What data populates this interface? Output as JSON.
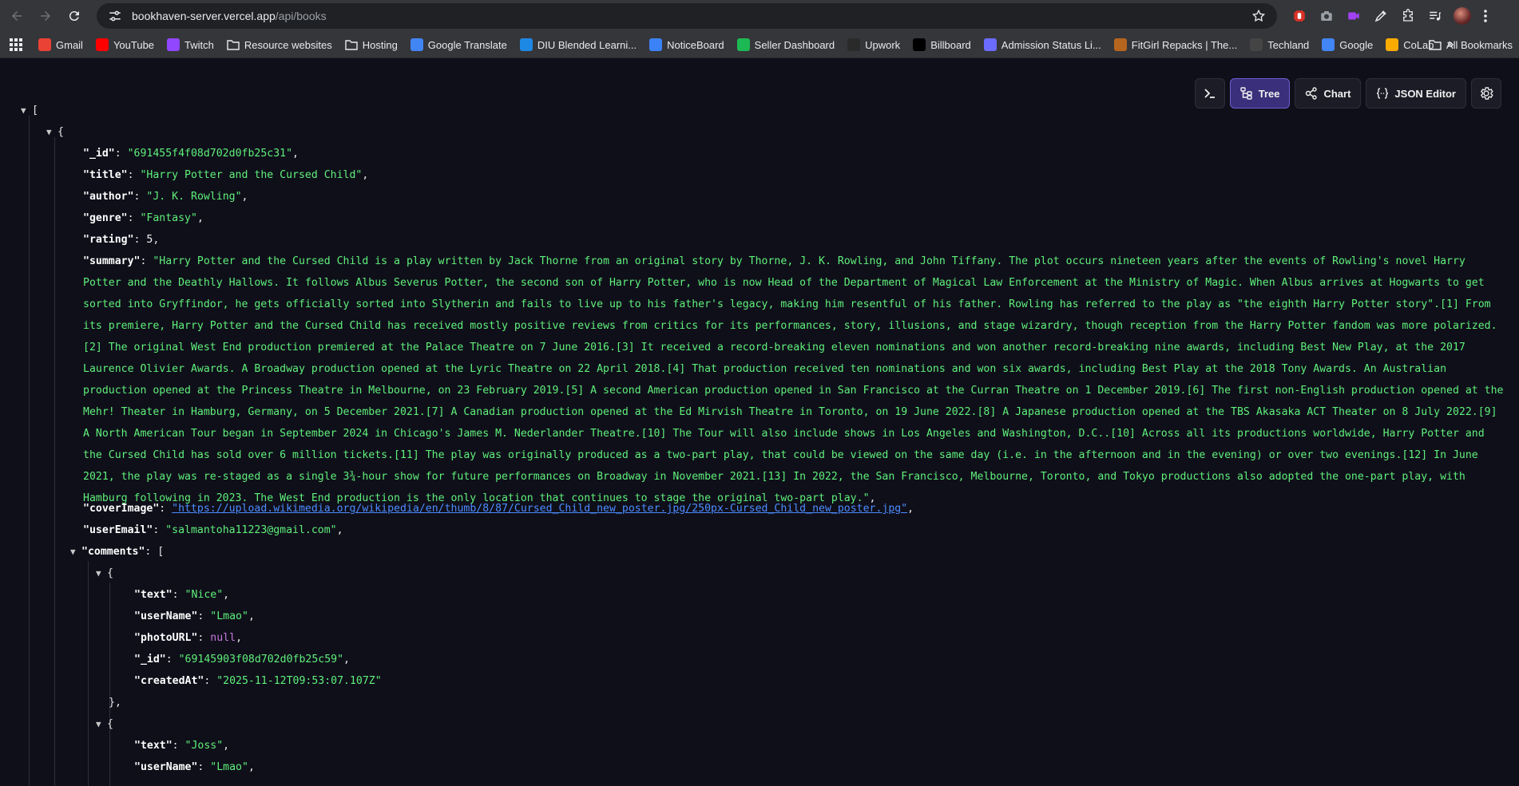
{
  "browser": {
    "url_host": "bookhaven-server.vercel.app",
    "url_path": "/api/books",
    "bookmarks": [
      {
        "label": "Gmail",
        "icon": "gmail-icon",
        "color": "#ea4335"
      },
      {
        "label": "YouTube",
        "icon": "youtube-icon",
        "color": "#ff0000"
      },
      {
        "label": "Twitch",
        "icon": "twitch-icon",
        "color": "#9146ff"
      },
      {
        "label": "Resource websites",
        "icon": "folder-icon",
        "color": ""
      },
      {
        "label": "Hosting",
        "icon": "folder-icon",
        "color": ""
      },
      {
        "label": "Google Translate",
        "icon": "translate-icon",
        "color": "#4285f4"
      },
      {
        "label": "DIU Blended Learni...",
        "icon": "diu-icon",
        "color": "#1e88e5"
      },
      {
        "label": "NoticeBoard",
        "icon": "noticeboard-icon",
        "color": "#3b82f6"
      },
      {
        "label": "Seller Dashboard",
        "icon": "seller-icon",
        "color": "#1db954"
      },
      {
        "label": "Upwork",
        "icon": "upwork-icon",
        "color": "#2a2a2a"
      },
      {
        "label": "Billboard",
        "icon": "billboard-icon",
        "color": "#000000"
      },
      {
        "label": "Admission Status Li...",
        "icon": "admission-icon",
        "color": "#6b6bff"
      },
      {
        "label": "FitGirl Repacks | The...",
        "icon": "fitgirl-icon",
        "color": "#b5651d"
      },
      {
        "label": "Techland",
        "icon": "techland-icon",
        "color": "#444444"
      },
      {
        "label": "Google",
        "icon": "google-icon",
        "color": "#4285f4"
      },
      {
        "label": "CoLab",
        "icon": "colab-icon",
        "color": "#f9ab00"
      }
    ],
    "all_bookmarks_label": "All Bookmarks"
  },
  "viewer": {
    "tree_label": "Tree",
    "chart_label": "Chart",
    "json_editor_label": "JSON Editor"
  },
  "json": {
    "open_bracket": "[",
    "open_brace": "{",
    "id_key": "\"_id\"",
    "id_val": "\"691455f4f08d702d0fb25c31\"",
    "title_key": "\"title\"",
    "title_val": "\"Harry Potter and the Cursed Child\"",
    "author_key": "\"author\"",
    "author_val": "\"J. K. Rowling\"",
    "genre_key": "\"genre\"",
    "genre_val": "\"Fantasy\"",
    "rating_key": "\"rating\"",
    "rating_val": "5",
    "summary_key": "\"summary\"",
    "summary_val": "\"Harry Potter and the Cursed Child is a play written by Jack Thorne from an original story by Thorne, J. K. Rowling, and John Tiffany. The plot occurs nineteen years after the events of Rowling's novel Harry Potter and the Deathly Hallows. It follows Albus Severus Potter, the second son of Harry Potter, who is now Head of the Department of Magical Law Enforcement at the Ministry of Magic. When Albus arrives at Hogwarts to get sorted into Gryffindor, he gets officially sorted into Slytherin and fails to live up to his father's legacy, making him resentful of his father. Rowling has referred to the play as \"the eighth Harry Potter story\".[1] From its premiere, Harry Potter and the Cursed Child has received mostly positive reviews from critics for its performances, story, illusions, and stage wizardry, though reception from the Harry Potter fandom was more polarized.[2] The original West End production premiered at the Palace Theatre on 7 June 2016.[3] It received a record-breaking eleven nominations and won another record-breaking nine awards, including Best New Play, at the 2017 Laurence Olivier Awards. A Broadway production opened at the Lyric Theatre on 22 April 2018.[4] That production received ten nominations and won six awards, including Best Play at the 2018 Tony Awards. An Australian production opened at the Princess Theatre in Melbourne, on 23 February 2019.[5] A second American production opened in San Francisco at the Curran Theatre on 1 December 2019.[6] The first non-English production opened at the Mehr! Theater in Hamburg, Germany, on 5 December 2021.[7] A Canadian production opened at the Ed Mirvish Theatre in Toronto, on 19 June 2022.[8] A Japanese production opened at the TBS Akasaka ACT Theater on 8 July 2022.[9] A North American Tour began in September 2024 in Chicago's James M. Nederlander Theatre.[10] The Tour will also include shows in Los Angeles and Washington, D.C..[10] Across all its productions worldwide, Harry Potter and the Cursed Child has sold over 6 million tickets.[11] The play was originally produced as a two-part play, that could be viewed on the same day (i.e. in the afternoon and in the evening) or over two evenings.[12] In June 2021, the play was re-staged as a single 3¾-hour show for future performances on Broadway in November 2021.[13] In 2022, the San Francisco, Melbourne, Toronto, and Tokyo productions also adopted the one-part play, with Hamburg following in 2023. The West End production is the only location that continues to stage the original two-part play.\"",
    "cover_key": "\"coverImage\"",
    "cover_val": "\"https://upload.wikimedia.org/wikipedia/en/thumb/8/87/Cursed_Child_new_poster.jpg/250px-Cursed_Child_new_poster.jpg\"",
    "email_key": "\"userEmail\"",
    "email_val": "\"salmantoha11223@gmail.com\"",
    "comments_key": "\"comments\"",
    "comments": [
      {
        "text_key": "\"text\"",
        "text_val": "\"Nice\"",
        "user_key": "\"userName\"",
        "user_val": "\"Lmao\"",
        "photo_key": "\"photoURL\"",
        "photo_val": "null",
        "id_key": "\"_id\"",
        "id_val": "\"69145903f08d702d0fb25c59\"",
        "created_key": "\"createdAt\"",
        "created_val": "\"2025-11-12T09:53:07.107Z\""
      },
      {
        "text_key": "\"text\"",
        "text_val": "\"Joss\"",
        "user_key": "\"userName\"",
        "user_val": "\"Lmao\""
      }
    ],
    "close_brace_comma": "},"
  }
}
